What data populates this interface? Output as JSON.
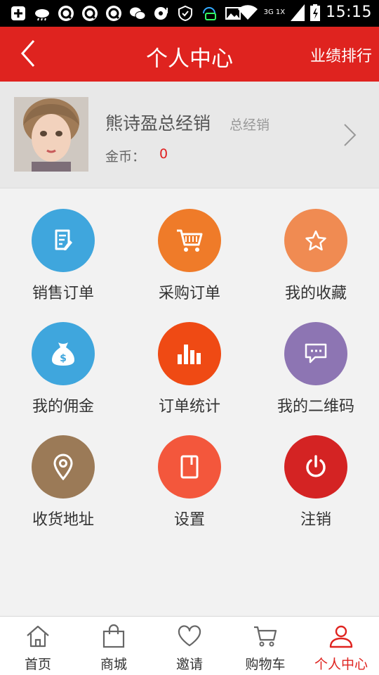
{
  "status_bar": {
    "time": "15:15",
    "network": "3G 1X",
    "icons": [
      "plus-icon",
      "weather-icon",
      "q-icon",
      "q-icon",
      "q-icon",
      "wechat-icon",
      "speech-icon",
      "shield-icon",
      "wifi-icon",
      "image-icon",
      "signal-icon",
      "battery-icon"
    ]
  },
  "header": {
    "title": "个人中心",
    "right_action": "业绩排行",
    "back_icon": "chevron-left-icon",
    "bg_color": "#df231f"
  },
  "profile": {
    "name": "熊诗盈总经销",
    "role": "总经销",
    "coin_label": "金币：",
    "coin_value": "0"
  },
  "menu": [
    {
      "label": "销售订单",
      "icon": "document-edit-icon",
      "color": "#3fa6dd"
    },
    {
      "label": "采购订单",
      "icon": "shopping-cart-icon",
      "color": "#ef7b29"
    },
    {
      "label": "我的收藏",
      "icon": "star-icon",
      "color": "#f08b52"
    },
    {
      "label": "我的佣金",
      "icon": "money-bag-icon",
      "color": "#3fa6dd"
    },
    {
      "label": "订单统计",
      "icon": "bar-chart-icon",
      "color": "#ef4a14"
    },
    {
      "label": "我的二维码",
      "icon": "message-icon",
      "color": "#8d75b3"
    },
    {
      "label": "收货地址",
      "icon": "location-pin-icon",
      "color": "#9b7a57"
    },
    {
      "label": "设置",
      "icon": "settings-page-icon",
      "color": "#f3573c"
    },
    {
      "label": "注销",
      "icon": "power-icon",
      "color": "#d42323"
    }
  ],
  "tabs": [
    {
      "label": "首页",
      "icon": "home-icon",
      "active": false
    },
    {
      "label": "商城",
      "icon": "shopping-bag-icon",
      "active": false
    },
    {
      "label": "邀请",
      "icon": "heart-icon",
      "active": false
    },
    {
      "label": "购物车",
      "icon": "cart-icon",
      "active": false
    },
    {
      "label": "个人中心",
      "icon": "user-icon",
      "active": true
    }
  ],
  "accent_color": "#df231f"
}
